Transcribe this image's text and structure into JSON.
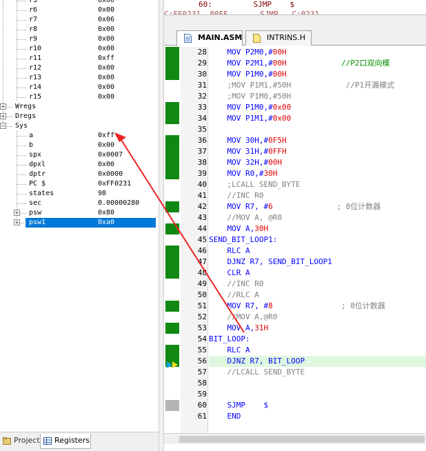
{
  "registers": {
    "rows": [
      {
        "name": "r5",
        "value": "0x00",
        "level": 2
      },
      {
        "name": "r6",
        "value": "0x00",
        "level": 2
      },
      {
        "name": "r7",
        "value": "0x06",
        "level": 2
      },
      {
        "name": "r8",
        "value": "0x00",
        "level": 2
      },
      {
        "name": "r9",
        "value": "0x00",
        "level": 2
      },
      {
        "name": "r10",
        "value": "0x00",
        "level": 2
      },
      {
        "name": "r11",
        "value": "0xff",
        "level": 2
      },
      {
        "name": "r12",
        "value": "0x00",
        "level": 2
      },
      {
        "name": "r13",
        "value": "0x00",
        "level": 2
      },
      {
        "name": "r14",
        "value": "0x00",
        "level": 2
      },
      {
        "name": "r15",
        "value": "0x00",
        "level": 2
      },
      {
        "name": "Wregs",
        "value": "",
        "level": 1,
        "expander": "+"
      },
      {
        "name": "Dregs",
        "value": "",
        "level": 1,
        "expander": "+"
      },
      {
        "name": "Sys",
        "value": "",
        "level": 1,
        "expander": "-"
      },
      {
        "name": "a",
        "value": "0xff",
        "level": 2
      },
      {
        "name": "b",
        "value": "0x00",
        "level": 2
      },
      {
        "name": "spx",
        "value": "0x0007",
        "level": 2
      },
      {
        "name": "dpxl",
        "value": "0x00",
        "level": 2
      },
      {
        "name": "dptr",
        "value": "0x0000",
        "level": 2
      },
      {
        "name": "PC  $",
        "value": "0xFF0231",
        "level": 2
      },
      {
        "name": "states",
        "value": "98",
        "level": 2
      },
      {
        "name": "sec",
        "value": "0.00000280",
        "level": 2
      },
      {
        "name": "psw",
        "value": "0x80",
        "level": 2,
        "expander": "+"
      },
      {
        "name": "psw1",
        "value": "0xa0",
        "level": 2,
        "expander": "+",
        "selected": true
      }
    ]
  },
  "bottom_tabs": {
    "project": "Project",
    "registers": "Registers"
  },
  "disasm": {
    "line1": "60:         SJMP    $",
    "line2": "C:FF0231  80FE       SJMP   C:0231"
  },
  "file_tabs": {
    "main": "MAIN.ASM",
    "intrins": "INTRINS.H"
  },
  "code": [
    {
      "n": "28",
      "mark": "green",
      "parts": [
        [
          "op",
          "    MOV P2M0,#"
        ],
        [
          "imm",
          "00H"
        ]
      ]
    },
    {
      "n": "29",
      "mark": "green",
      "parts": [
        [
          "op",
          "    MOV P2M1,#"
        ],
        [
          "imm",
          "00H"
        ],
        [
          "cm",
          "            //P2口双向模"
        ]
      ]
    },
    {
      "n": "30",
      "mark": "green",
      "parts": [
        [
          "op",
          "    MOV P1M0,#"
        ],
        [
          "imm",
          "00H"
        ]
      ]
    },
    {
      "n": "31",
      "mark": "",
      "parts": [
        [
          "cmt",
          "    ;MOV P1M1,#50H            //P1开漏模式"
        ]
      ]
    },
    {
      "n": "32",
      "mark": "",
      "parts": [
        [
          "cmt",
          "    ;MOV P1M0,#50H"
        ]
      ]
    },
    {
      "n": "33",
      "mark": "green",
      "parts": [
        [
          "op",
          "    MOV P1M0,#"
        ],
        [
          "imm",
          "0x00"
        ]
      ]
    },
    {
      "n": "34",
      "mark": "green",
      "parts": [
        [
          "op",
          "    MOV P1M1,#"
        ],
        [
          "imm",
          "0x00"
        ]
      ]
    },
    {
      "n": "35",
      "mark": "",
      "parts": [
        [
          "op",
          ""
        ]
      ]
    },
    {
      "n": "36",
      "mark": "green",
      "parts": [
        [
          "op",
          "    MOV 30H,#"
        ],
        [
          "imm",
          "0F5H"
        ]
      ]
    },
    {
      "n": "37",
      "mark": "green",
      "parts": [
        [
          "op",
          "    MOV 31H,#"
        ],
        [
          "imm",
          "0FFH"
        ]
      ]
    },
    {
      "n": "38",
      "mark": "green",
      "parts": [
        [
          "op",
          "    MOV 32H,#"
        ],
        [
          "imm",
          "00H"
        ]
      ]
    },
    {
      "n": "39",
      "mark": "green",
      "parts": [
        [
          "op",
          "    MOV R0,#"
        ],
        [
          "imm",
          "30H"
        ]
      ]
    },
    {
      "n": "40",
      "mark": "",
      "parts": [
        [
          "cmt",
          "    ;LCALL SEND_BYTE"
        ]
      ]
    },
    {
      "n": "41",
      "mark": "",
      "parts": [
        [
          "cmt",
          "    //INC R0"
        ]
      ]
    },
    {
      "n": "42",
      "mark": "green",
      "parts": [
        [
          "op",
          "    MOV R7, #"
        ],
        [
          "imm",
          "6"
        ],
        [
          "cmt",
          "              ; 8位计数器"
        ]
      ]
    },
    {
      "n": "43",
      "mark": "",
      "parts": [
        [
          "cmt",
          "    //MOV A, @R0"
        ]
      ]
    },
    {
      "n": "44",
      "mark": "green",
      "parts": [
        [
          "op",
          "    MOV A,"
        ],
        [
          "imm",
          "30H"
        ]
      ]
    },
    {
      "n": "45",
      "mark": "",
      "parts": [
        [
          "lbl",
          "SEND_BIT_LOOP1:"
        ]
      ]
    },
    {
      "n": "46",
      "mark": "green",
      "parts": [
        [
          "op",
          "    RLC A"
        ]
      ]
    },
    {
      "n": "47",
      "mark": "green",
      "parts": [
        [
          "op",
          "    DJNZ R7, "
        ],
        [
          "blk",
          "SEND_BIT_LOOP1"
        ]
      ]
    },
    {
      "n": "48",
      "mark": "green",
      "parts": [
        [
          "op",
          "    CLR A"
        ]
      ]
    },
    {
      "n": "49",
      "mark": "",
      "parts": [
        [
          "cmt",
          "    //INC R0"
        ]
      ]
    },
    {
      "n": "50",
      "mark": "",
      "parts": [
        [
          "cmt",
          "    //RLC A"
        ]
      ]
    },
    {
      "n": "51",
      "mark": "green",
      "parts": [
        [
          "op",
          "    MOV R7, #"
        ],
        [
          "imm",
          "8"
        ],
        [
          "cmt",
          "               ; 8位计数器"
        ]
      ]
    },
    {
      "n": "52",
      "mark": "",
      "parts": [
        [
          "cmt",
          "    //MOV A,@R0"
        ]
      ]
    },
    {
      "n": "53",
      "mark": "green",
      "parts": [
        [
          "op",
          "    MOV A,"
        ],
        [
          "imm",
          "31H"
        ]
      ]
    },
    {
      "n": "54",
      "mark": "",
      "parts": [
        [
          "lbl",
          "BIT_LOOP:"
        ]
      ]
    },
    {
      "n": "55",
      "mark": "green",
      "parts": [
        [
          "op",
          "    RLC A"
        ]
      ]
    },
    {
      "n": "56",
      "mark": "green",
      "current": true,
      "parts": [
        [
          "op",
          "    DJNZ R7, BIT_LOOP"
        ]
      ]
    },
    {
      "n": "57",
      "mark": "",
      "parts": [
        [
          "cmt",
          "    //LCALL SEND_BYTE"
        ]
      ]
    },
    {
      "n": "58",
      "mark": "",
      "parts": [
        [
          "op",
          ""
        ]
      ]
    },
    {
      "n": "59",
      "mark": "",
      "parts": [
        [
          "op",
          ""
        ]
      ]
    },
    {
      "n": "60",
      "mark": "gray",
      "parts": [
        [
          "op",
          "    SJMP    $"
        ]
      ]
    },
    {
      "n": "61",
      "mark": "",
      "parts": [
        [
          "op",
          "    END"
        ]
      ]
    }
  ],
  "colors": {
    "coverage": "#118811",
    "selection": "#0078d7",
    "arrow": "#ee2222",
    "current_line": "#dff7df"
  }
}
